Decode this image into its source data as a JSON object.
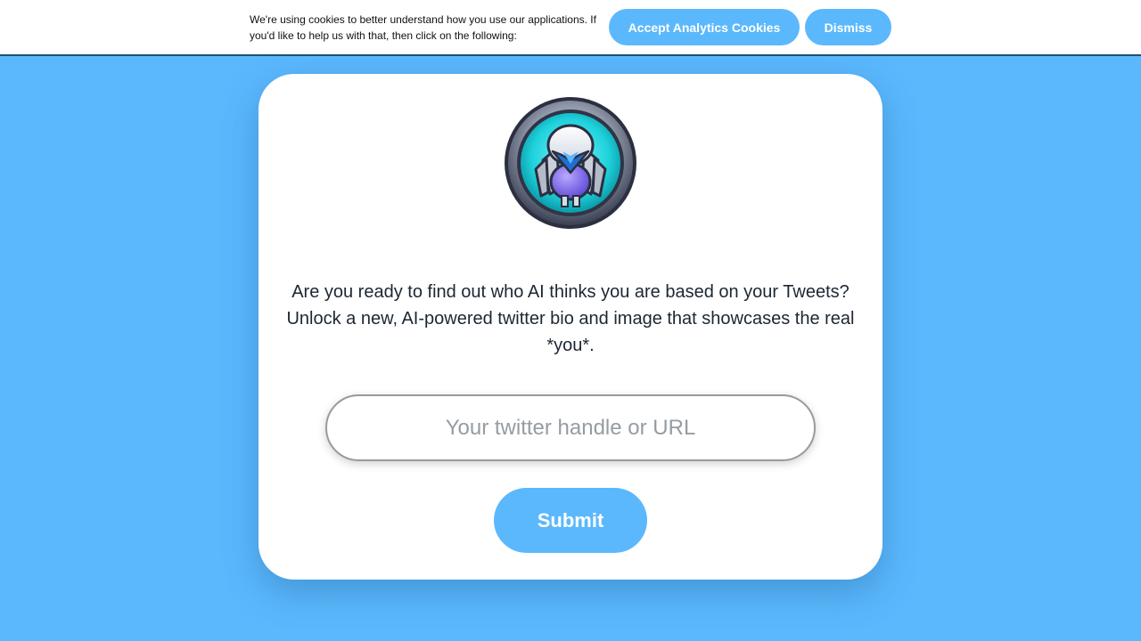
{
  "cookie_banner": {
    "message": "We're using cookies to better understand how you use our applications. If you'd like to help us with that, then click on the following:",
    "accept_label": "Accept Analytics Cookies",
    "dismiss_label": "Dismiss"
  },
  "main": {
    "logo_icon": "robot-avatar-icon",
    "tagline": "Are you ready to find out who AI thinks you are based on your Tweets? Unlock a new, AI-powered twitter bio and image that showcases the real *you*.",
    "handle_input": {
      "value": "",
      "placeholder": "Your twitter handle or URL"
    },
    "submit_label": "Submit"
  },
  "colors": {
    "background": "#5bb8fd",
    "accent": "#5bb8fd",
    "card": "#ffffff",
    "text": "#1c2733"
  }
}
